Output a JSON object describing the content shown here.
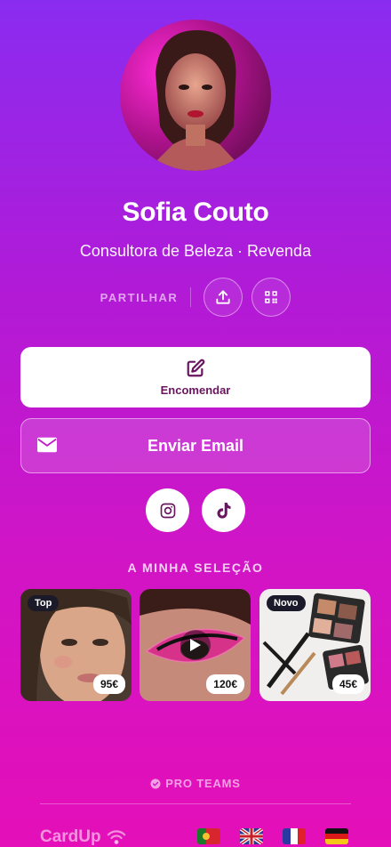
{
  "profile": {
    "name": "Sofia Couto",
    "role": "Consultora de Beleza · Revenda"
  },
  "share": {
    "label": "PARTILHAR"
  },
  "actions": {
    "order_label": "Encomendar",
    "email_label": "Enviar Email"
  },
  "socials": [
    "instagram-icon",
    "tiktok-icon"
  ],
  "selection": {
    "title": "A MINHA SELEÇÃO",
    "items": [
      {
        "tag": "Top",
        "price": "95€"
      },
      {
        "tag": "",
        "price": "120€"
      },
      {
        "tag": "Novo",
        "price": "45€"
      }
    ]
  },
  "footer": {
    "pro_label": "PRO TEAMS",
    "brand": "CardUp",
    "languages": [
      "pt",
      "en",
      "fr",
      "de"
    ]
  },
  "colors": {
    "accent": "#6a1560",
    "bg_top": "#8a2cf0",
    "bg_bottom": "#e40fb8"
  }
}
